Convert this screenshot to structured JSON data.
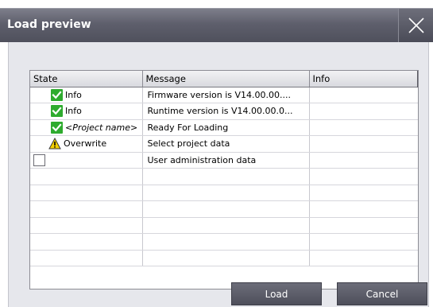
{
  "window": {
    "title": "Load preview",
    "close_icon": "close-icon"
  },
  "grid": {
    "columns": [
      "State",
      "Message",
      "Info"
    ],
    "rows": [
      {
        "state_icon": "check-icon",
        "state": "Info",
        "italic": false,
        "message": "Firmware version is V14.00.00....",
        "info": ""
      },
      {
        "state_icon": "check-icon",
        "state": "Info",
        "italic": false,
        "message": "Runtime version is V14.00.00.0...",
        "info": ""
      },
      {
        "state_icon": "check-icon",
        "state": "<Project name>",
        "italic": true,
        "message": "Ready For Loading",
        "info": ""
      },
      {
        "state_icon": "warning-icon",
        "state": "Overwrite",
        "italic": false,
        "message": "Select project data",
        "info": ""
      },
      {
        "state_icon": "checkbox-icon",
        "state": "",
        "italic": false,
        "message": "User administration data",
        "info": ""
      }
    ],
    "empty_rows": 6
  },
  "buttons": {
    "load": "Load",
    "cancel": "Cancel"
  },
  "colors": {
    "title_bar": "#5e5f6c",
    "content_bg": "#e6e7ec",
    "check_green": "#2eab2e",
    "warning_yellow": "#f5d000"
  }
}
